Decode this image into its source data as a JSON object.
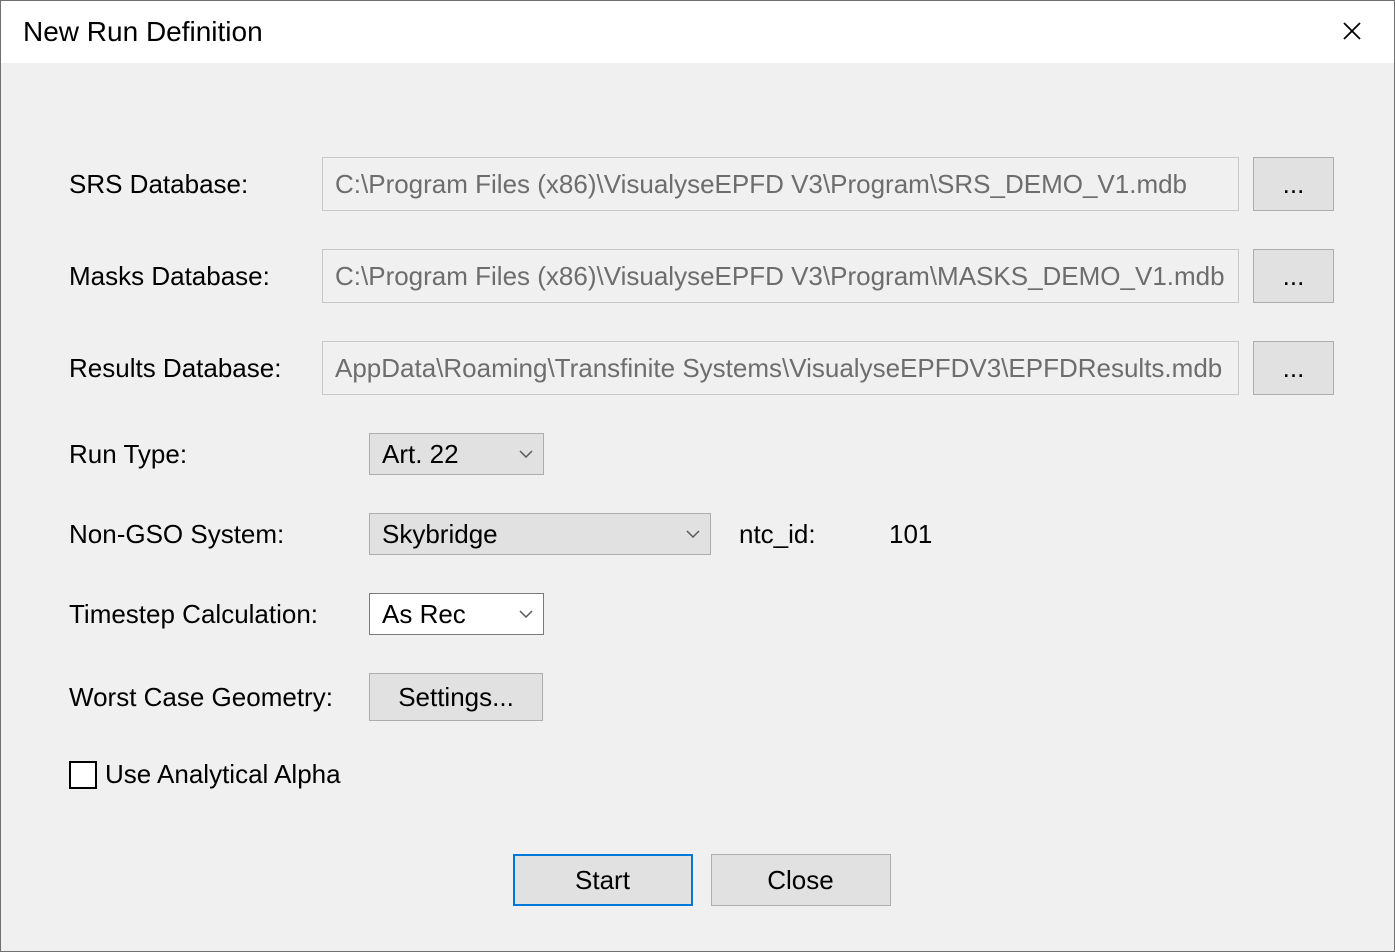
{
  "dialog": {
    "title": "New Run Definition"
  },
  "fields": {
    "srs": {
      "label": "SRS Database:",
      "value": "C:\\Program Files (x86)\\VisualyseEPFD V3\\Program\\SRS_DEMO_V1.mdb",
      "browse": "..."
    },
    "masks": {
      "label": "Masks Database:",
      "value": "C:\\Program Files (x86)\\VisualyseEPFD V3\\Program\\MASKS_DEMO_V1.mdb",
      "browse": "..."
    },
    "results": {
      "label": "Results Database:",
      "value": "AppData\\Roaming\\Transfinite Systems\\VisualyseEPFDV3\\EPFDResults.mdb",
      "browse": "..."
    },
    "run_type": {
      "label": "Run Type:",
      "value": "Art. 22"
    },
    "non_gso": {
      "label": "Non-GSO System:",
      "value": "Skybridge",
      "ntc_label": "ntc_id:",
      "ntc_value": "101"
    },
    "timestep": {
      "label": "Timestep Calculation:",
      "value": "As Rec"
    },
    "wcg": {
      "label": "Worst Case Geometry:",
      "button": "Settings..."
    },
    "alpha": {
      "label": "Use Analytical Alpha",
      "checked": false
    }
  },
  "buttons": {
    "start": "Start",
    "close": "Close"
  }
}
